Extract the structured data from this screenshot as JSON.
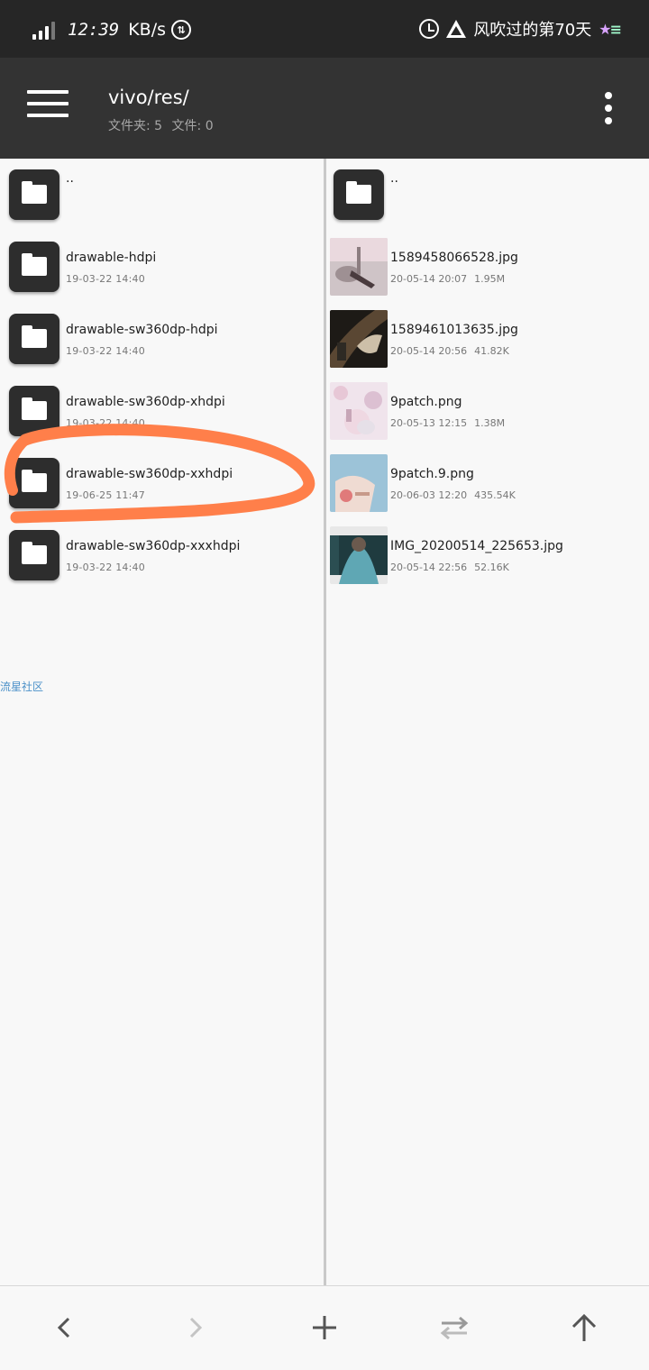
{
  "status_bar": {
    "time": "12:39",
    "speed": "KB/s",
    "speed_icon_glyph": "⇅",
    "song_text": "风吹过的第70天",
    "icons": [
      "signal-icon",
      "data-speed-icon",
      "alarm-icon",
      "warning-triangle-icon",
      "shooting-star-icon"
    ]
  },
  "app_bar": {
    "path": "vivo/res/",
    "folder_count_label": "文件夹: 5",
    "file_count_label": "文件: 0",
    "icons": [
      "menu-icon",
      "more-vert-icon"
    ]
  },
  "left_pane": {
    "items": [
      {
        "name": "..",
        "date": "",
        "size": ""
      },
      {
        "name": "drawable-hdpi",
        "date": "19-03-22 14:40",
        "size": ""
      },
      {
        "name": "drawable-sw360dp-hdpi",
        "date": "19-03-22 14:40",
        "size": ""
      },
      {
        "name": "drawable-sw360dp-xhdpi",
        "date": "19-03-22 14:40",
        "size": ""
      },
      {
        "name": "drawable-sw360dp-xxhdpi",
        "date": "19-06-25 11:47",
        "size": ""
      },
      {
        "name": "drawable-sw360dp-xxxhdpi",
        "date": "19-03-22 14:40",
        "size": ""
      }
    ],
    "watermark": "流星社区"
  },
  "right_pane": {
    "items": [
      {
        "name": "..",
        "date": "",
        "size": "",
        "kind": "folder"
      },
      {
        "name": "1589458066528.jpg",
        "date": "20-05-14 20:07",
        "size": "1.95M",
        "kind": "image"
      },
      {
        "name": "1589461013635.jpg",
        "date": "20-05-14 20:56",
        "size": "41.82K",
        "kind": "image"
      },
      {
        "name": "9patch.png",
        "date": "20-05-13 12:15",
        "size": "1.38M",
        "kind": "image"
      },
      {
        "name": "9patch.9.png",
        "date": "20-06-03 12:20",
        "size": "435.54K",
        "kind": "image"
      },
      {
        "name": "IMG_20200514_225653.jpg",
        "date": "20-05-14 22:56",
        "size": "52.16K",
        "kind": "image"
      }
    ]
  },
  "annotation_color": "#ff7f4a",
  "bottom_bar": {
    "icons": [
      "back-icon",
      "forward-icon",
      "add-icon",
      "swap-icon",
      "up-icon"
    ],
    "forward_enabled": false
  },
  "colors": {
    "status_bar_bg": "#262626",
    "app_bar_bg": "#333333",
    "folder_tile": "#2d2d2d",
    "watermark": "#4a90c8"
  }
}
